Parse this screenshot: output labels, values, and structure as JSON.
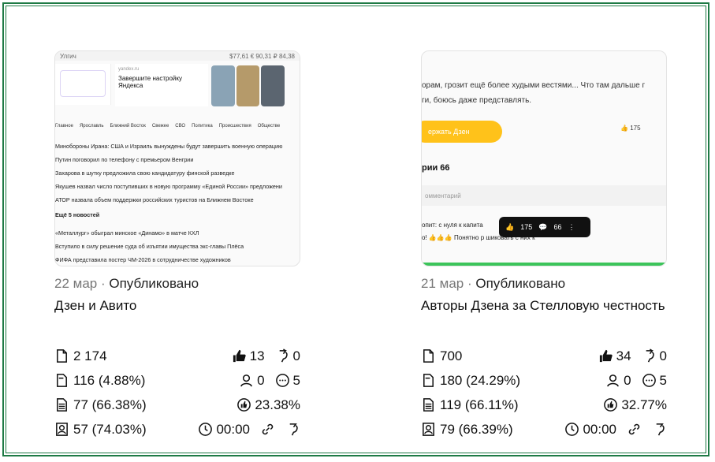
{
  "cards": [
    {
      "date": "22 мар",
      "separator": "·",
      "status": "Опубликовано",
      "title": "Дзен и Авито",
      "thumb": {
        "top_left": "Улгич",
        "top_right": "$77,61  € 90,31  ₽ 84,38",
        "ya_domain": "yandex.ru",
        "ya_text": "Завершите настройку Яндекса",
        "tabs": [
          "Главное",
          "Ярославль",
          "Ближний Восток",
          "Свежее",
          "СВО",
          "Политика",
          "Происшествия",
          "Обществе"
        ],
        "news": [
          "Минобороны Ирана: США и Израиль вынуждены будут завершить военную операцию",
          "Путин поговорил по телефону с премьером Венгрии",
          "Захарова в шутку предложила свою кандидатуру финской разведке",
          "Якушев назвал число поступивших в новую программу «Единой России» предложени",
          "АТОР назвала объем поддержки российских туристов на Ближнем Востоке"
        ],
        "more": "Ещё 5 новостей",
        "news2": [
          "«Металлург» обыграл минское «Динамо» в матче КХЛ",
          "Вступило в силу решение суда об изъятии имущества экс-главы Плёса",
          "ФИФА представила постер ЧМ-2026 в сотрудничестве художников"
        ]
      },
      "stats": {
        "views": "2 174",
        "likes": "13",
        "reposts": "0",
        "opens": "116 (4.88%)",
        "subs": "0",
        "comments": "5",
        "reads": "77 (66.38%)",
        "ctr": "23.38%",
        "full_reads": "57 (74.03%)",
        "time": "00:00"
      }
    },
    {
      "date": "21 мар",
      "separator": "·",
      "status": "Опубликовано",
      "title": "Авторы Дзена за Стелловую честность",
      "thumb": {
        "text1": "орам, грозит ещё более худыми вестями... Что там дальше г",
        "text2": "ги, боюсь даже представлять.",
        "button": "ержать Дзен",
        "likes": "175",
        "comments_title": "рии 66",
        "input": "омментарий",
        "overlay_likes": "175",
        "overlay_comments": "66",
        "line1": "опит: с нуля к капита",
        "line2": "о! 👍👍👍 Понятно р                       шиковать с них к"
      },
      "stats": {
        "views": "700",
        "likes": "34",
        "reposts": "0",
        "opens": "180 (24.29%)",
        "subs": "0",
        "comments": "5",
        "reads": "119 (66.11%)",
        "ctr": "32.77%",
        "full_reads": "79 (66.39%)",
        "time": "00:00"
      }
    }
  ],
  "colors": {
    "frame": "#1e7a45",
    "accent": "#ffc21a"
  }
}
